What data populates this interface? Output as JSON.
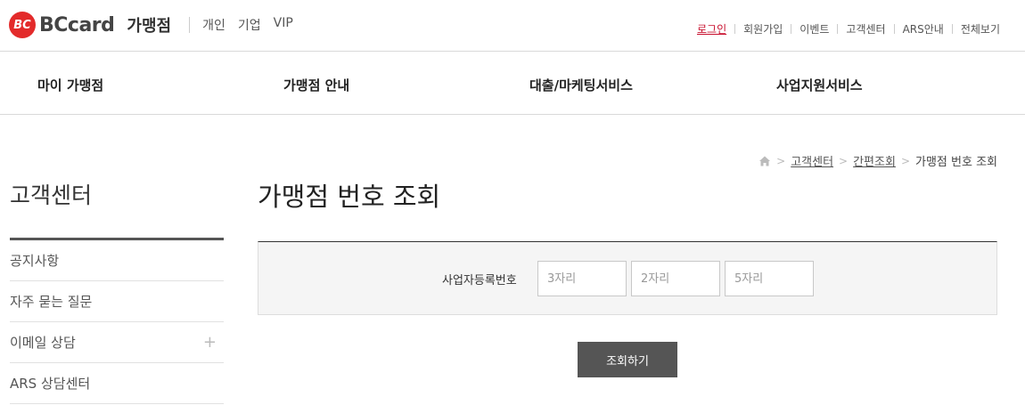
{
  "header": {
    "logo_mark": "BC",
    "logo_text": "BCcard",
    "logo_sub": "가맹점",
    "segments": [
      "개인",
      "기업",
      "VIP"
    ],
    "util_links": [
      "로그인",
      "회원가입",
      "이벤트",
      "고객센터",
      "ARS안내",
      "전체보기"
    ]
  },
  "gnb": {
    "items": [
      "마이 가맹점",
      "가맹점 안내",
      "대출/마케팅서비스",
      "사업지원서비스"
    ]
  },
  "sidebar": {
    "title": "고객센터",
    "items": [
      "공지사항",
      "자주 묻는 질문",
      "이메일 상담",
      "ARS 상담센터"
    ]
  },
  "breadcrumb": {
    "items": [
      "고객센터",
      "간편조회",
      "가맹점 번호 조회"
    ]
  },
  "main": {
    "title": "가맹점 번호 조회",
    "form": {
      "label": "사업자등록번호",
      "inputs": [
        {
          "placeholder": "3자리",
          "value": ""
        },
        {
          "placeholder": "2자리",
          "value": ""
        },
        {
          "placeholder": "5자리",
          "value": ""
        }
      ]
    },
    "submit_label": "조회하기"
  },
  "colors": {
    "brand_red": "#e32b2b",
    "login_red": "#c8102e",
    "button_gray": "#555555"
  }
}
